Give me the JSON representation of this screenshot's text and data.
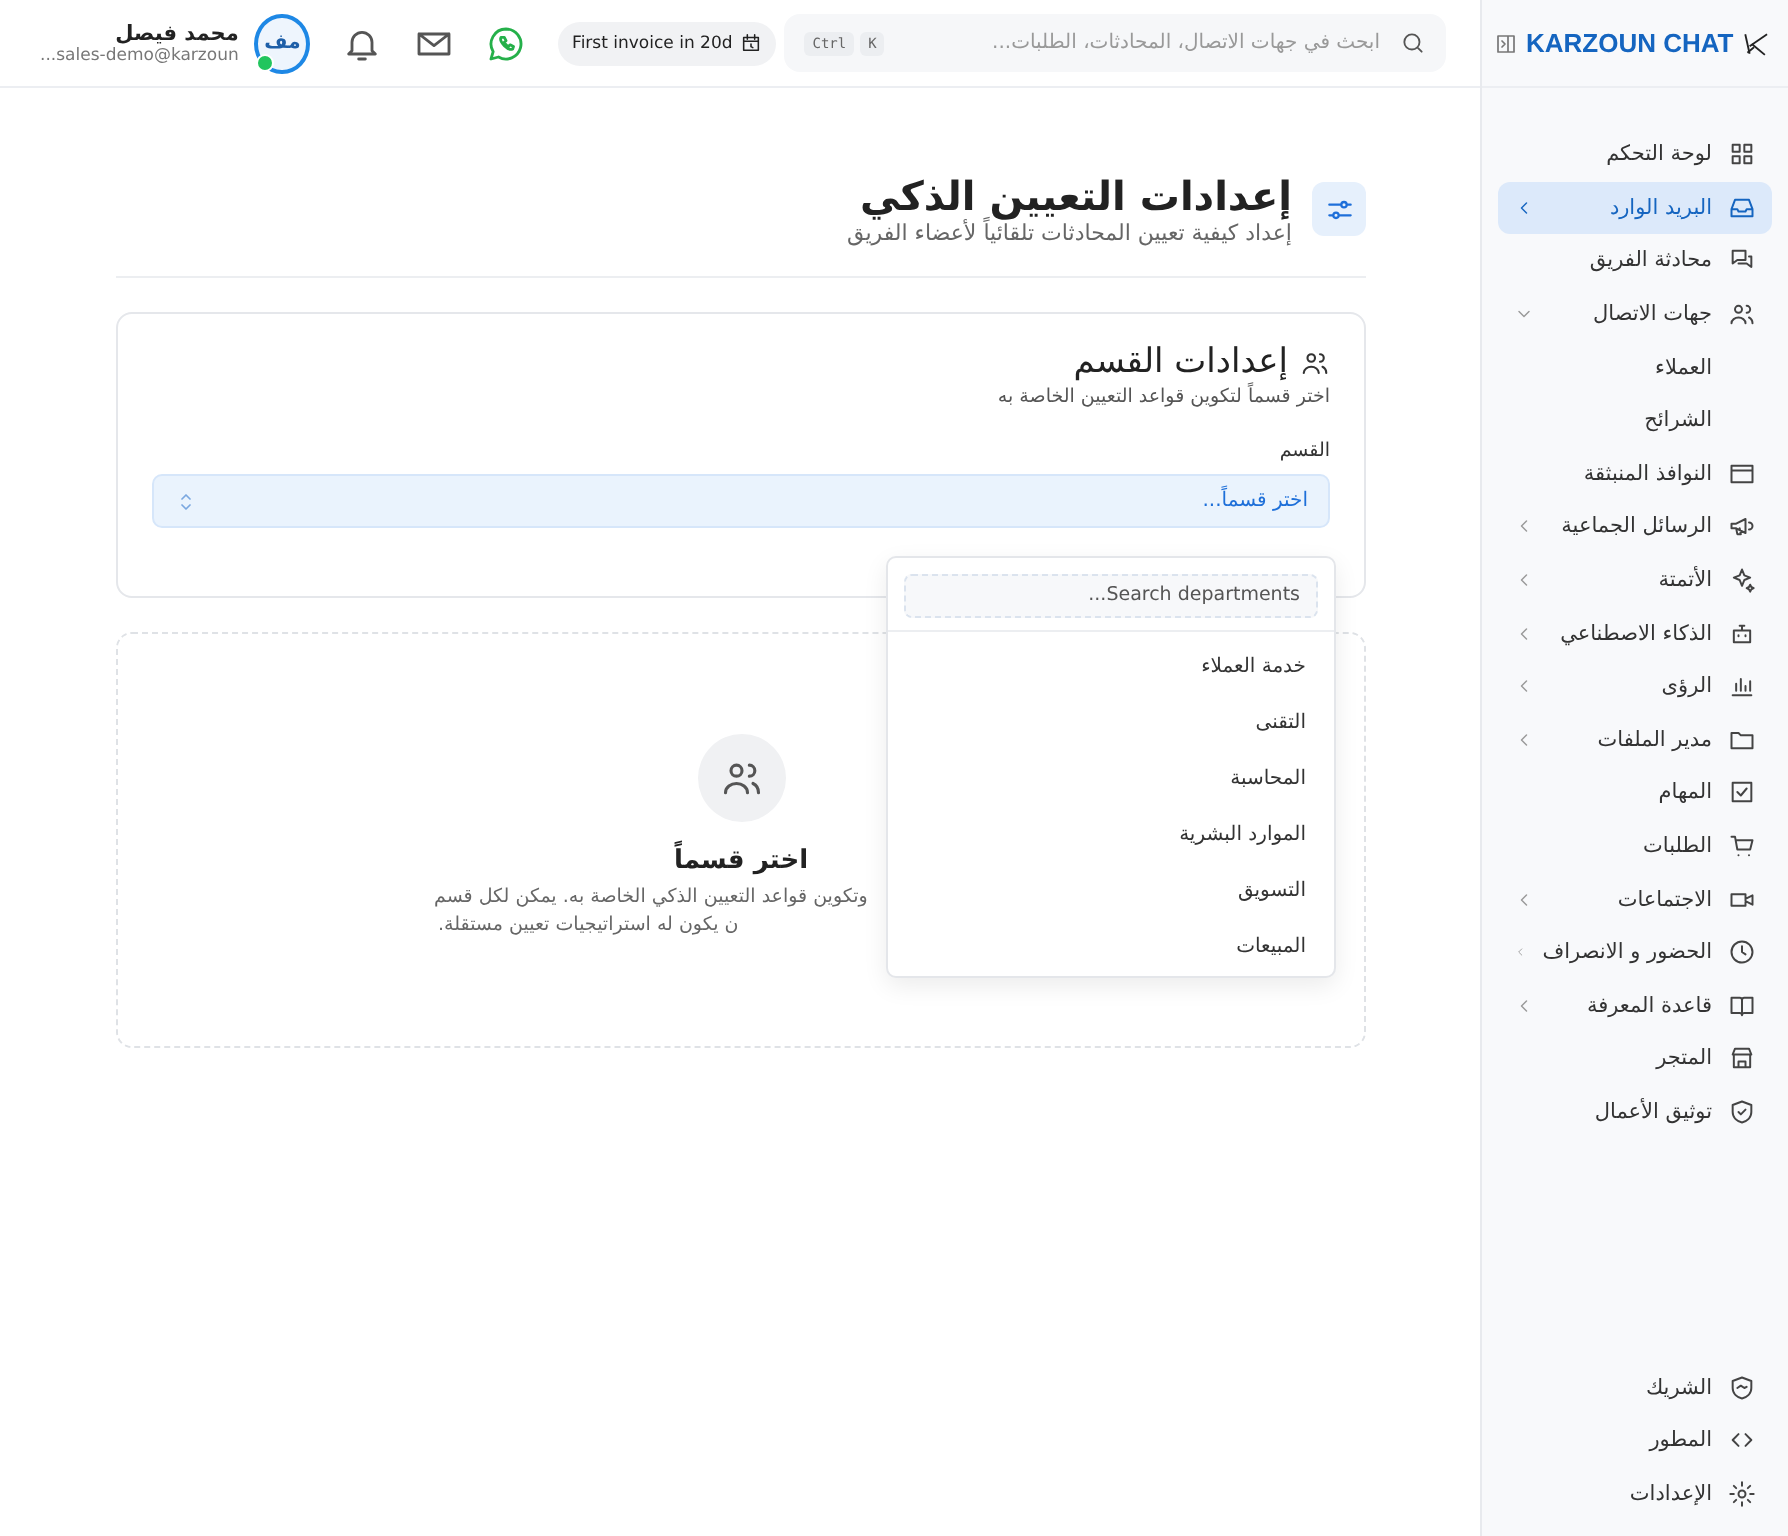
{
  "sidebar": {
    "logo": "KARZOUN CHAT",
    "items": [
      {
        "label": "لوحة التحكم",
        "selected": false
      },
      {
        "label": "البريد الوارد",
        "selected": true,
        "expanded": false
      },
      {
        "label": "محادثة الفريق",
        "selected": false
      },
      {
        "label": "جهات الاتصال",
        "selected": false,
        "expanded": true,
        "children": [
          {
            "label": "العملاء",
            "selected": false
          },
          {
            "label": "الشرائح",
            "selected": false
          }
        ]
      },
      {
        "label": "النوافذ المنبثقة",
        "selected": false
      },
      {
        "label": "الرسائل الجماعية",
        "selected": false,
        "expanded": false
      },
      {
        "label": "الأتمتة",
        "selected": false,
        "expanded": false
      },
      {
        "label": "الذكاء الاصطناعي",
        "selected": false,
        "expanded": false
      },
      {
        "label": "الرؤى",
        "selected": false,
        "expanded": false
      },
      {
        "label": "مدير الملفات",
        "selected": false,
        "expanded": false
      },
      {
        "label": "المهام",
        "selected": false
      },
      {
        "label": "الطلبات",
        "selected": false
      },
      {
        "label": "الاجتماعات",
        "selected": false,
        "expanded": false
      },
      {
        "label": "الحضور و الانصراف",
        "selected": false,
        "expanded": false
      },
      {
        "label": "قاعدة المعرفة",
        "selected": false,
        "expanded": false
      },
      {
        "label": "المتجر",
        "selected": false
      },
      {
        "label": "توثيق الأعمال",
        "selected": false
      }
    ],
    "bottom_items": [
      {
        "label": "الشريك",
        "selected": false
      },
      {
        "label": "المطور",
        "selected": false
      },
      {
        "label": "الإعدادات",
        "selected": false
      }
    ]
  },
  "topbar": {
    "search": {
      "placeholder": "ابحث في جهات الاتصال، المحادثات، الطلبات..."
    },
    "shortcut_keys": [
      "K",
      "Ctrl"
    ],
    "trial_badge": "First invoice in 20d",
    "user": {
      "initials": "مف",
      "online": true,
      "name": "محمد فيصل",
      "email": "sales-demo@karzoun..."
    }
  },
  "page": {
    "title": "إعدادات التعيين الذكي",
    "subtitle": "إعداد كيفية تعيين المحادثات تلقائياً لأعضاء الفريق"
  },
  "department_card": {
    "title": "إعدادات القسم",
    "subtitle": "اختر قسماً لتكوين قواعد التعيين الخاصة به",
    "field_label": "القسم",
    "select": {
      "value": "اختر قسماً...",
      "open": true
    },
    "dropdown": {
      "search": {
        "placeholder": "Search departments..."
      },
      "options": [
        "خدمة العملاء",
        "التقنى",
        "المحاسبة",
        "الموارد البشرية",
        "التسويق",
        "المبيعات"
      ]
    }
  },
  "empty_state": {
    "title": "اختر قسماً",
    "description_lines": [
      "وتكوين قواعد التعيين الذكي الخاصة به. يمكن لكل قسم",
      "ن يكون له استراتيجيات تعيين مستقلة."
    ]
  }
}
